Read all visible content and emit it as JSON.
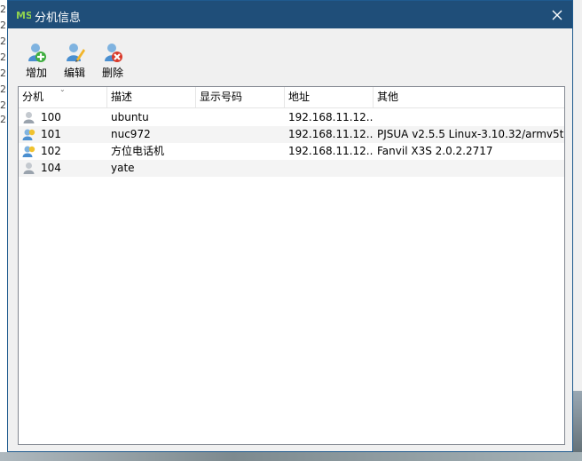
{
  "window": {
    "title": "分机信息"
  },
  "toolbar": {
    "add_label": "增加",
    "edit_label": "编辑",
    "delete_label": "删除"
  },
  "columns": [
    "分机",
    "描述",
    "显示号码",
    "地址",
    "其他"
  ],
  "rows": [
    {
      "ext": "100",
      "desc": "ubuntu",
      "display": "",
      "address": "192.168.11.12...",
      "other": "",
      "status": "offline",
      "icon": "user-offline-icon"
    },
    {
      "ext": "101",
      "desc": "nuc972",
      "display": "",
      "address": "192.168.11.12...",
      "other": "PJSUA v2.5.5 Linux-3.10.32/armv5t...",
      "status": "online",
      "icon": "user-online-icon"
    },
    {
      "ext": "102",
      "desc": "方位电话机",
      "display": "",
      "address": "192.168.11.12...",
      "other": "Fanvil X3S 2.0.2.2717",
      "status": "online",
      "icon": "user-online-icon"
    },
    {
      "ext": "104",
      "desc": "yate",
      "display": "",
      "address": "",
      "other": "",
      "status": "offline",
      "icon": "user-offline-icon"
    }
  ],
  "background": {
    "left_fragments": [
      "2",
      "2",
      "2",
      "2",
      "2",
      "2",
      "2",
      "2"
    ]
  },
  "colors": {
    "titlebar": "#1f4e79",
    "online_icon": "#f0c22e",
    "offline_icon": "#9aa3ad"
  }
}
